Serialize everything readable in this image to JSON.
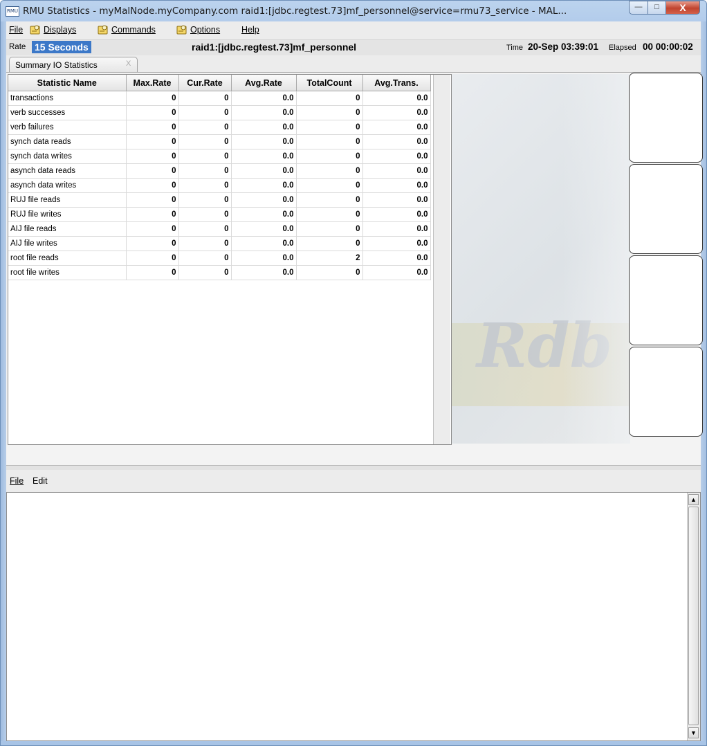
{
  "window": {
    "app_icon_text": "RMU",
    "title": "RMU Statistics - myMalNode.myCompany.com raid1:[jdbc.regtest.73]mf_personnel@service=rmu73_service - MAL...",
    "controls": {
      "minimize": "—",
      "maximize": "□",
      "close": "X"
    }
  },
  "menubar": {
    "file": "File",
    "displays": "Displays",
    "commands": "Commands",
    "options": "Options",
    "help": "Help"
  },
  "infobar": {
    "rate_label": "Rate",
    "rate_value": "15 Seconds",
    "database": "raid1:[jdbc.regtest.73]mf_personnel",
    "time_label": "Time",
    "time_value": "20-Sep 03:39:01",
    "elapsed_label": "Elapsed",
    "elapsed_value": "00 00:00:02"
  },
  "tab": {
    "label": "Summary IO Statistics",
    "close": "X"
  },
  "table": {
    "columns": [
      "Statistic Name",
      "Max.Rate",
      "Cur.Rate",
      "Avg.Rate",
      "TotalCount",
      "Avg.Trans."
    ],
    "rows": [
      [
        "transactions",
        "0",
        "0",
        "0.0",
        "0",
        "0.0"
      ],
      [
        "verb successes",
        "0",
        "0",
        "0.0",
        "0",
        "0.0"
      ],
      [
        "verb failures",
        "0",
        "0",
        "0.0",
        "0",
        "0.0"
      ],
      [
        "synch data reads",
        "0",
        "0",
        "0.0",
        "0",
        "0.0"
      ],
      [
        "synch data writes",
        "0",
        "0",
        "0.0",
        "0",
        "0.0"
      ],
      [
        "asynch data reads",
        "0",
        "0",
        "0.0",
        "0",
        "0.0"
      ],
      [
        "asynch data writes",
        "0",
        "0",
        "0.0",
        "0",
        "0.0"
      ],
      [
        "RUJ file reads",
        "0",
        "0",
        "0.0",
        "0",
        "0.0"
      ],
      [
        "RUJ file writes",
        "0",
        "0",
        "0.0",
        "0",
        "0.0"
      ],
      [
        "AIJ file reads",
        "0",
        "0",
        "0.0",
        "0",
        "0.0"
      ],
      [
        "AIJ file writes",
        "0",
        "0",
        "0.0",
        "0",
        "0.0"
      ],
      [
        "root file reads",
        "0",
        "0",
        "0.0",
        "2",
        "0.0"
      ],
      [
        "root file writes",
        "0",
        "0",
        "0.0",
        "0",
        "0.0"
      ]
    ]
  },
  "watermark": "Rdb",
  "lower_menubar": {
    "file": "File",
    "edit": "Edit"
  },
  "colors": {
    "rate_highlight": "#3c78c8",
    "close_button": "#c1442f",
    "window_frame": "#a9c5e8"
  }
}
